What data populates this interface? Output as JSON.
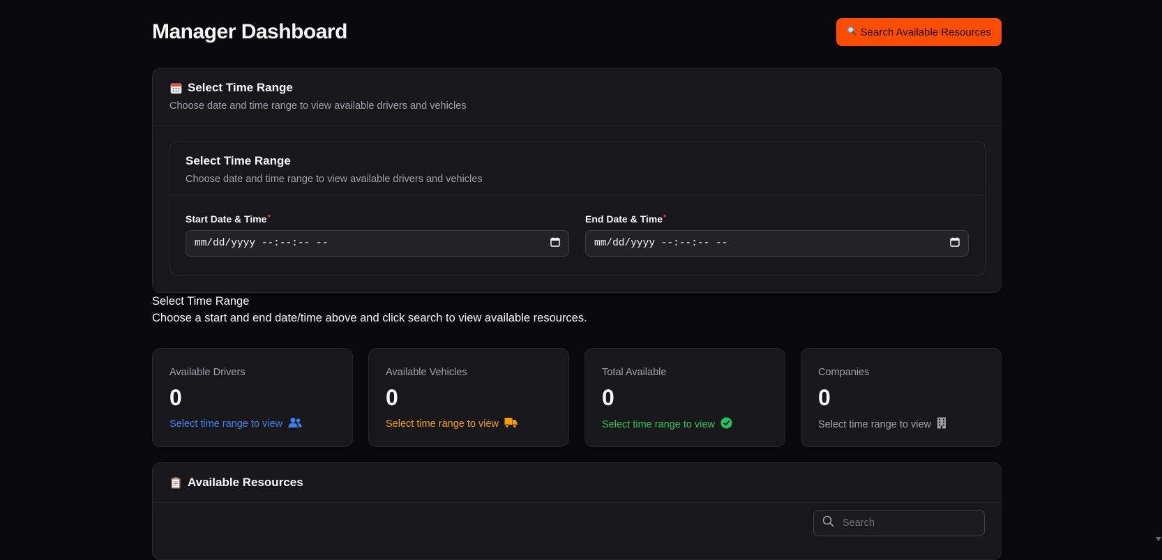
{
  "header": {
    "title": "Manager Dashboard",
    "search_button_label": "Search Available Resources",
    "search_button_icon": "magnifier-icon"
  },
  "time_range_card": {
    "icon": "calendar-icon",
    "title": "Select Time Range",
    "description": "Choose date and time range to view available drivers and vehicles",
    "inner": {
      "title": "Select Time Range",
      "description": "Choose date and time range to view available drivers and vehicles",
      "start_label": "Start Date & Time",
      "start_value": "mm/dd/yyyy --:--:-- --",
      "end_label": "End Date & Time",
      "end_value": "mm/dd/yyyy --:--:-- --",
      "required_mark": "*"
    }
  },
  "prompt": {
    "title": "Select Time Range",
    "description": "Choose a start and end date/time above and click search to view available resources."
  },
  "stats": [
    {
      "label": "Available Drivers",
      "value": "0",
      "hint": "Select time range to view",
      "hint_color": "#3b82f6",
      "icon": "users-icon"
    },
    {
      "label": "Available Vehicles",
      "value": "0",
      "hint": "Select time range to view",
      "hint_color": "#f59e0b",
      "icon": "truck-icon"
    },
    {
      "label": "Total Available",
      "value": "0",
      "hint": "Select time range to view",
      "hint_color": "#22c55e",
      "icon": "check-circle-icon"
    },
    {
      "label": "Companies",
      "value": "0",
      "hint": "Select time range to view",
      "hint_color": "#a1a1aa",
      "icon": "building-icon"
    }
  ],
  "resources_card": {
    "icon": "clipboard-icon",
    "title": "Available Resources",
    "search_placeholder": "Search"
  },
  "colors": {
    "accent": "#ff4d00",
    "background": "#09090b",
    "card": "#18181b"
  }
}
